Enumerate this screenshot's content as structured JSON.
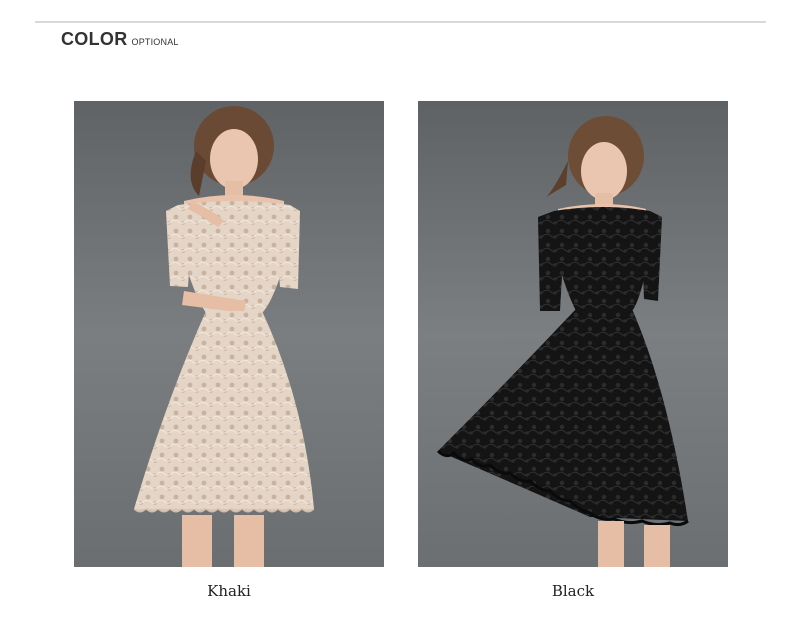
{
  "section": {
    "title": "COLOR",
    "subtitle": "OPTIONAL"
  },
  "colors": {
    "khaki": {
      "label": "Khaki",
      "swatch": "#e3d3c3"
    },
    "black": {
      "label": "Black",
      "swatch": "#151515"
    }
  },
  "theme": {
    "photo_background": "#6f7375",
    "skin": "#e8c2ab",
    "hair": "#6a4a35"
  }
}
